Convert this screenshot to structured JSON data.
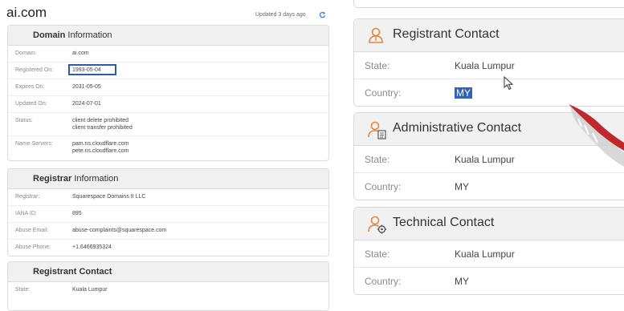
{
  "header": {
    "site": "ai.com",
    "updated": "Updated 3 days ago"
  },
  "domain_info": {
    "title_a": "Domain",
    "title_b": "Information",
    "rows": [
      {
        "label": "Domain:",
        "value": "ai.com"
      },
      {
        "label": "Registered On:",
        "value": "1993-05-04"
      },
      {
        "label": "Expires On:",
        "value": "2031-05-05"
      },
      {
        "label": "Updated On:",
        "value": "2024-07-01"
      },
      {
        "label": "Status:",
        "value1": "client delete prohibited",
        "value2": "client transfer prohibited"
      },
      {
        "label": "Name Servers:",
        "value1": "pam.ns.cloudflare.com",
        "value2": "pete.ns.cloudflare.com"
      }
    ]
  },
  "registrar_info": {
    "title_a": "Registrar",
    "title_b": "Information",
    "rows": [
      {
        "label": "Registrar:",
        "value": "Squarespace Domains II LLC"
      },
      {
        "label": "IANA ID:",
        "value": "895"
      },
      {
        "label": "Abuse Email:",
        "value": "abuse-complaints@squarespace.com"
      },
      {
        "label": "Abuse Phone:",
        "value": "+1.6466935324"
      }
    ]
  },
  "registrant_small": {
    "title": "Registrant Contact",
    "rows": [
      {
        "label": "State:",
        "value": "Kuala Lumpur"
      }
    ]
  },
  "right": {
    "registrant": {
      "title": "Registrant Contact",
      "state_label": "State:",
      "state": "Kuala Lumpur",
      "country_label": "Country:",
      "country": "MY"
    },
    "administrative": {
      "title": "Administrative Contact",
      "state_label": "State:",
      "state": "Kuala Lumpur",
      "country_label": "Country:",
      "country": "MY"
    },
    "technical": {
      "title": "Technical Contact",
      "state_label": "State:",
      "state": "Kuala Lumpur",
      "country_label": "Country:",
      "country": "MY"
    }
  },
  "colors": {
    "accent": "#e8833a",
    "highlight_box": "#2a5ca8",
    "selection": "#2e63b8"
  }
}
